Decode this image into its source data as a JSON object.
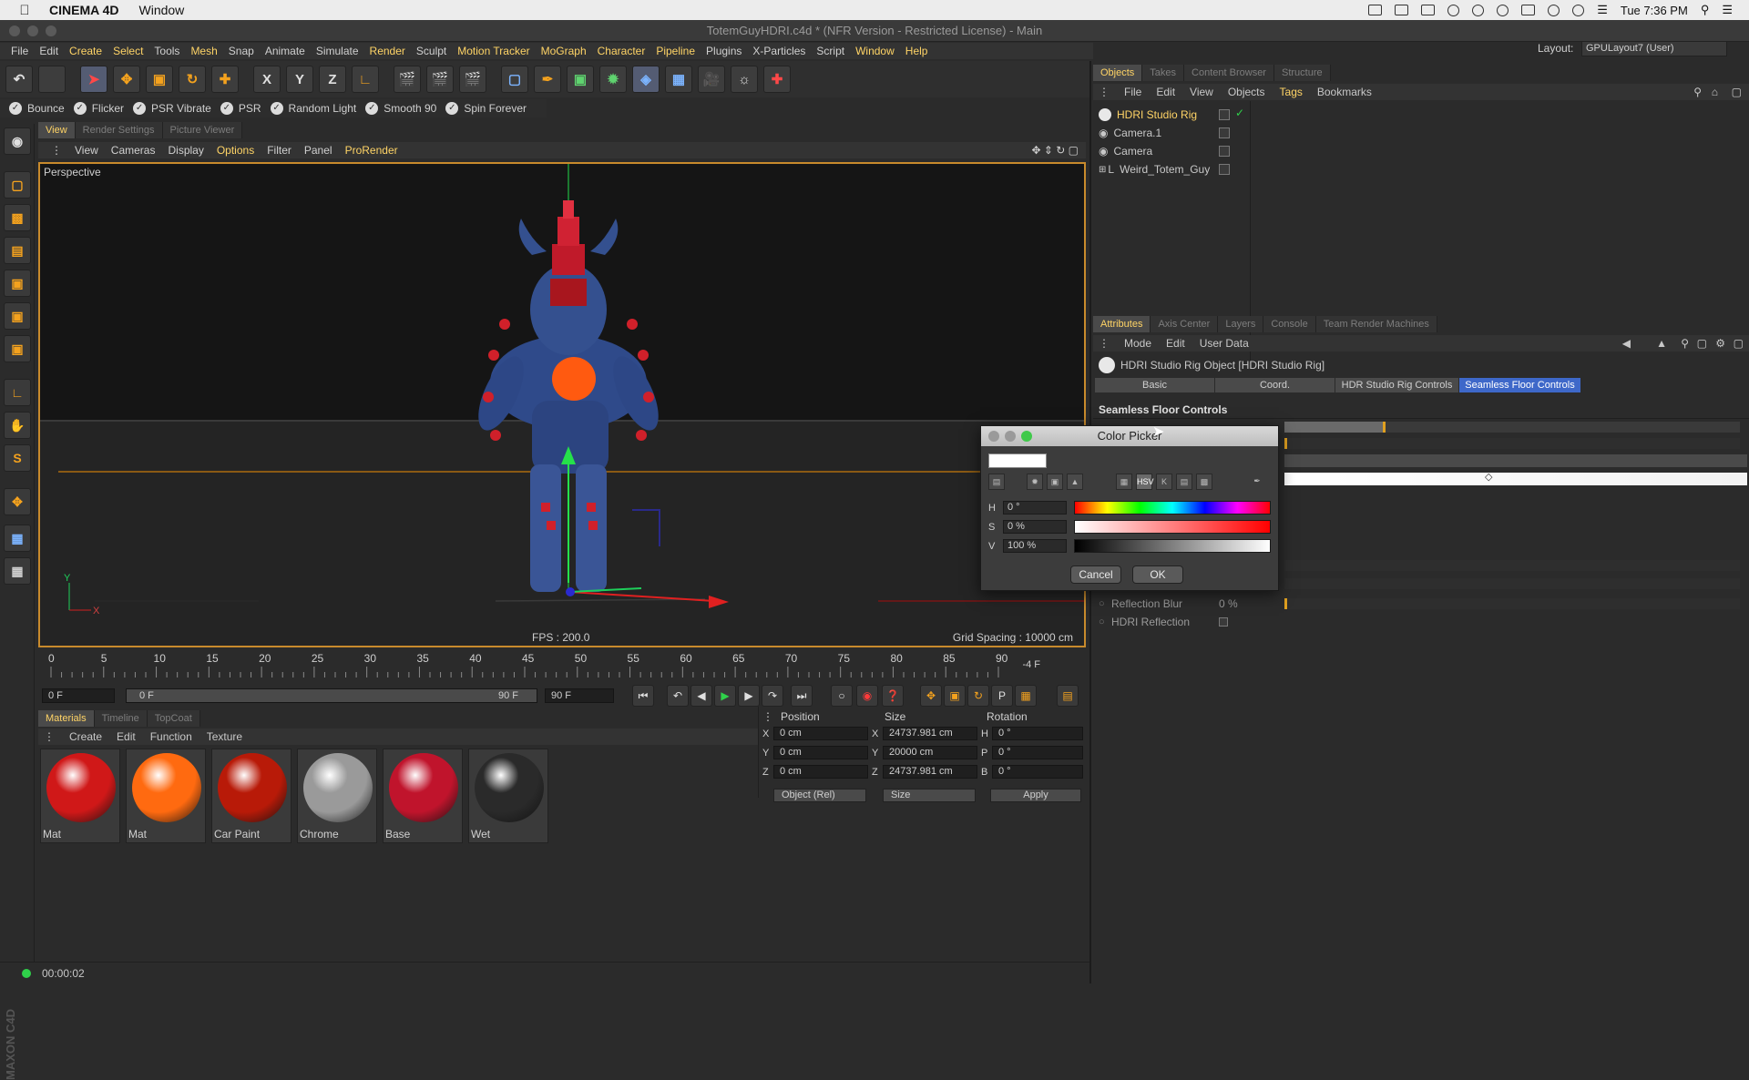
{
  "mac_menubar": {
    "app_name": "CINEMA 4D",
    "menus": [
      "Window"
    ],
    "clock": "Tue 7:36 PM"
  },
  "window": {
    "title": "TotemGuyHDRI.c4d * (NFR Version - Restricted License) - Main"
  },
  "main_menu": [
    "File",
    "Edit",
    "Create",
    "Select",
    "Tools",
    "Mesh",
    "Snap",
    "Animate",
    "Simulate",
    "Render",
    "Sculpt",
    "Motion Tracker",
    "MoGraph",
    "Character",
    "Pipeline",
    "Plugins",
    "X-Particles",
    "Script",
    "Window",
    "Help"
  ],
  "layout": {
    "label": "Layout:",
    "value": "GPULayout7 (User)"
  },
  "toolbar": {
    "x": "X",
    "y": "Y",
    "z": "Z"
  },
  "presets": [
    "Bounce",
    "Flicker",
    "PSR Vibrate",
    "PSR",
    "Random Light",
    "Smooth 90",
    "Spin Forever"
  ],
  "view_tabs": [
    "View",
    "Render Settings",
    "Picture Viewer"
  ],
  "view_menu": [
    "View",
    "Cameras",
    "Display",
    "Options",
    "Filter",
    "Panel",
    "ProRender"
  ],
  "viewport": {
    "label": "Perspective",
    "fps": "FPS : 200.0",
    "grid_spacing": "Grid Spacing : 10000 cm",
    "axis_y": "Y",
    "axis_x": "X"
  },
  "timeline": {
    "ticks": [
      "0",
      "5",
      "10",
      "15",
      "20",
      "25",
      "30",
      "35",
      "40",
      "45",
      "50",
      "55",
      "60",
      "65",
      "70",
      "75",
      "80",
      "85",
      "90"
    ],
    "current": "-4 F"
  },
  "playback": {
    "start": "0 F",
    "range_start": "0 F",
    "range_end": "90 F",
    "end": "90 F"
  },
  "material_tabs": [
    "Materials",
    "Timeline",
    "TopCoat"
  ],
  "material_menu": [
    "Create",
    "Edit",
    "Function",
    "Texture"
  ],
  "materials": [
    {
      "name": "Mat",
      "color": "#d01818"
    },
    {
      "name": "Mat",
      "color": "#ff6a10"
    },
    {
      "name": "Car Paint",
      "color": "#b81a08"
    },
    {
      "name": "Chrome",
      "color": "#9a9a9a"
    },
    {
      "name": "Base",
      "color": "#c0142c"
    },
    {
      "name": "Wet",
      "color": "#2a2a2a"
    }
  ],
  "coords": {
    "position": "Position",
    "size": "Size",
    "rotation": "Rotation",
    "px": "0 cm",
    "py": "0 cm",
    "pz": "0 cm",
    "sx": "24737.981 cm",
    "sy": "20000 cm",
    "sz": "24737.981 cm",
    "rh": "0 °",
    "rp": "0 °",
    "rb": "0 °",
    "mode": "Object (Rel)",
    "size_mode": "Size",
    "apply": "Apply",
    "lx": "X",
    "ly": "Y",
    "lz": "Z",
    "lsx": "X",
    "lsy": "Y",
    "lsz": "Z",
    "lh": "H",
    "lp": "P",
    "lb": "B"
  },
  "status": {
    "time": "00:00:02"
  },
  "object_tabs": [
    "Objects",
    "Takes",
    "Content Browser",
    "Structure"
  ],
  "object_menu": [
    "File",
    "Edit",
    "View",
    "Objects",
    "Tags",
    "Bookmarks"
  ],
  "objects": [
    "HDRI Studio Rig",
    "Camera.1",
    "Camera",
    "Weird_Totem_Guy"
  ],
  "attr_tabs_top": [
    "Attributes",
    "Axis Center",
    "Layers",
    "Console",
    "Team Render Machines"
  ],
  "attr_menu": [
    "Mode",
    "Edit",
    "User Data"
  ],
  "attributes": {
    "object_title": "HDRI Studio Rig Object [HDRI Studio Rig]",
    "tabs": [
      "Basic",
      "Coord.",
      "HDR Studio Rig Controls",
      "Seamless Floor Controls"
    ],
    "section": "Seamless Floor Controls",
    "reflection_blur_label": "Reflection Blur",
    "reflection_blur_value": "0 %",
    "hdri_reflection_label": "HDRI Reflection"
  },
  "color_picker": {
    "title": "Color Picker",
    "h_label": "H",
    "s_label": "S",
    "v_label": "V",
    "h_value": "0 °",
    "s_value": "0 %",
    "v_value": "100 %",
    "cancel": "Cancel",
    "ok": "OK",
    "mode_hsv": "HSV",
    "current_color": "#ffffff"
  }
}
